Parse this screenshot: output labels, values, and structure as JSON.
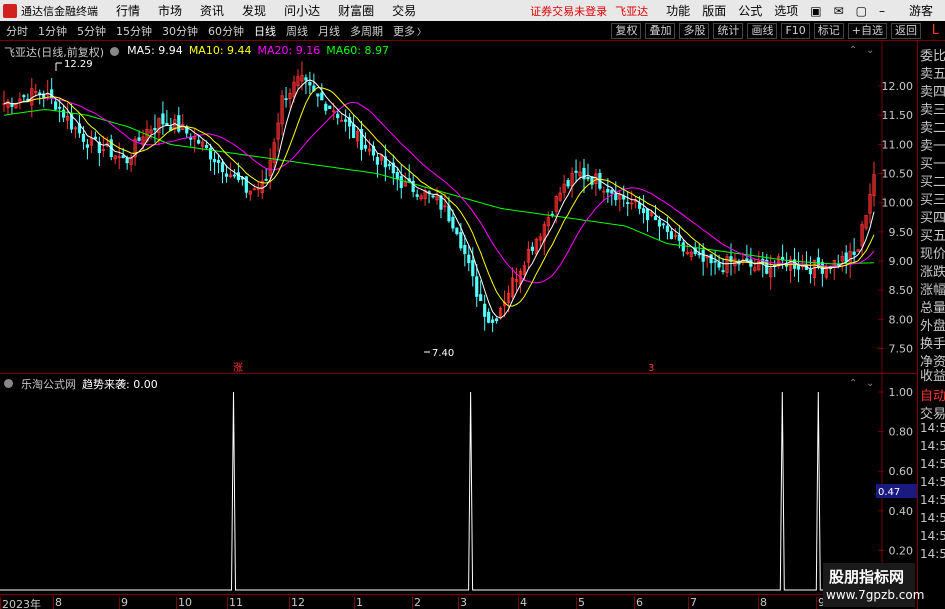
{
  "menubar": {
    "app_name": "通达信金融终端",
    "menu": [
      "行情",
      "市场",
      "资讯",
      "发现",
      "问小达",
      "财富圈",
      "交易"
    ],
    "warning": "证券交易未登录",
    "stock_name": "飞亚达",
    "right": [
      "功能",
      "版面",
      "公式",
      "选项"
    ],
    "guest": "游客"
  },
  "periodbar": {
    "items": [
      "分时",
      "1分钟",
      "5分钟",
      "15分钟",
      "30分钟",
      "60分钟",
      "日线",
      "周线",
      "月线",
      "多周期",
      "更多"
    ],
    "active": "日线",
    "right_buttons": [
      "复权",
      "叠加",
      "多股",
      "统计",
      "画线",
      "F10",
      "标记",
      "+自选",
      "返回"
    ],
    "corner": "L"
  },
  "main_legend": {
    "title": "飞亚达(日线,前复权)",
    "ma5": "MA5: 9.94",
    "ma10": "MA10: 9.44",
    "ma20": "MA20: 9.16",
    "ma60": "MA60: 8.97",
    "high_label": "12.29",
    "low_label": "7.40",
    "marker1": "涨",
    "marker2": "3"
  },
  "sub_legend": {
    "source": "乐淘公式网",
    "indicator": "趋势来袭: 0.00"
  },
  "right_panel": {
    "labels": [
      "委比",
      "卖五",
      "卖四",
      "卖三",
      "卖二",
      "卖一",
      "买一",
      "买二",
      "买三",
      "买四",
      "买五",
      "现价",
      "涨跌",
      "涨幅",
      "总量",
      "外盘",
      "换手",
      "净资",
      "收益"
    ],
    "auto": "自动",
    "trade": "交易",
    "times": [
      "14:5",
      "14:5",
      "14:5",
      "14:5",
      "14:5",
      "14:5",
      "14:5",
      "14:5"
    ]
  },
  "x_axis": [
    "2023年",
    "8",
    "9",
    "10",
    "11",
    "12",
    "1",
    "2",
    "3",
    "4",
    "5",
    "6",
    "7",
    "8",
    "9"
  ],
  "watermark": {
    "line1": "股朋指标网",
    "line2": "www.7gpzb.com"
  },
  "colors": {
    "up": "#ff3333",
    "down": "#54ffff",
    "ma5": "#ffffff",
    "ma10": "#ffff00",
    "ma20": "#ff00ff",
    "ma60": "#00ff00"
  },
  "chart_data": [
    {
      "type": "candlestick",
      "title": "飞亚达(日线,前复权)",
      "ylim": [
        7.2,
        12.6
      ],
      "y_ticks": [
        12.0,
        11.5,
        11.0,
        10.5,
        10.0,
        9.5,
        9.0,
        8.5,
        8.0,
        7.5
      ],
      "close_path": [
        11.7,
        11.8,
        11.9,
        11.7,
        11.3,
        11.0,
        10.9,
        10.7,
        11.2,
        11.4,
        11.3,
        11.1,
        10.8,
        10.5,
        10.2,
        10.3,
        11.8,
        12.1,
        11.8,
        11.6,
        11.2,
        10.9,
        10.6,
        10.3,
        10.2,
        10.0,
        9.6,
        8.6,
        7.9,
        8.5,
        9.1,
        9.6,
        10.2,
        10.5,
        10.4,
        10.2,
        10.0,
        9.8,
        9.5,
        9.2,
        9.0,
        8.9,
        9.0,
        8.9,
        8.9,
        9.0,
        8.9,
        8.9,
        9.0,
        9.1,
        10.5
      ],
      "ma60_path": [
        11.5,
        11.6,
        11.5,
        11.3,
        11.0,
        10.9,
        10.8,
        10.7,
        10.6,
        10.5,
        10.3,
        10.1,
        9.9,
        9.8,
        9.7,
        9.6,
        9.3,
        9.2,
        9.1,
        9.0,
        8.95,
        8.97
      ],
      "high_marker": 12.29,
      "low_marker": 7.4
    },
    {
      "type": "line",
      "title": "趋势来袭",
      "ylim": [
        0.0,
        1.0
      ],
      "y_ticks": [
        1.0,
        0.8,
        0.6,
        0.4,
        0.2
      ],
      "current": 0.47,
      "spikes_at_fraction": [
        0.266,
        0.536,
        0.891,
        0.932
      ]
    }
  ]
}
